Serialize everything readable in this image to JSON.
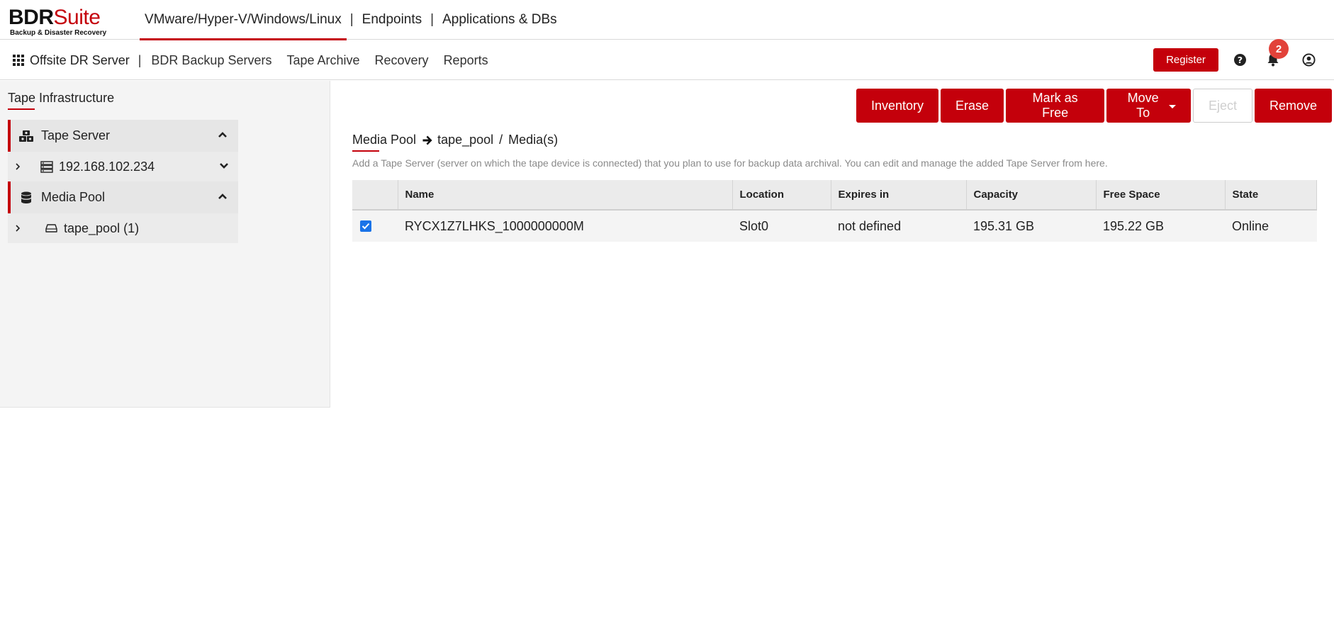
{
  "brand": {
    "name_dark": "BDR",
    "name_red": "Suite",
    "tagline": "Backup & Disaster Recovery"
  },
  "top_nav": {
    "items": [
      "VMware/Hyper-V/Windows/Linux",
      "Endpoints",
      "Applications & DBs"
    ],
    "separator": "|"
  },
  "sub_nav": {
    "lead": "Offsite DR Server",
    "separator": "|",
    "items": [
      "BDR Backup Servers",
      "Tape Archive",
      "Recovery",
      "Reports"
    ]
  },
  "header_tools": {
    "register_label": "Register",
    "notification_count": "2",
    "icons": [
      "help-icon",
      "bell-icon",
      "user-icon"
    ]
  },
  "sidebar": {
    "title": "Tape Infrastructure",
    "sections": [
      {
        "label": "Tape Server",
        "icon": "tape-server-icon",
        "children": [
          {
            "label": "192.168.102.234",
            "icon": "server-icon"
          }
        ]
      },
      {
        "label": "Media Pool",
        "icon": "database-icon",
        "children": [
          {
            "label": "tape_pool (1)",
            "icon": "drive-icon"
          }
        ]
      }
    ]
  },
  "actions": {
    "inventory": "Inventory",
    "erase": "Erase",
    "mark_free": "Mark as Free",
    "move_to": "Move To",
    "eject": "Eject",
    "remove": "Remove"
  },
  "breadcrumb": {
    "root": "Media Pool",
    "pool": "tape_pool",
    "separator": "/",
    "leaf": "Media(s)"
  },
  "description": "Add a Tape Server (server on which the tape device is connected) that you plan to use for backup data archival. You can edit and manage the added Tape Server from here.",
  "table": {
    "columns": [
      "Name",
      "Location",
      "Expires in",
      "Capacity",
      "Free Space",
      "State"
    ],
    "rows": [
      {
        "checked": true,
        "name": "RYCX1Z7LHKS_1000000000M",
        "location": "Slot0",
        "expires": "not defined",
        "capacity": "195.31 GB",
        "free": "195.22 GB",
        "state": "Online"
      }
    ]
  },
  "colors": {
    "accent": "#c4000b",
    "badge": "#e2423a",
    "checkbox": "#1a73e8"
  }
}
